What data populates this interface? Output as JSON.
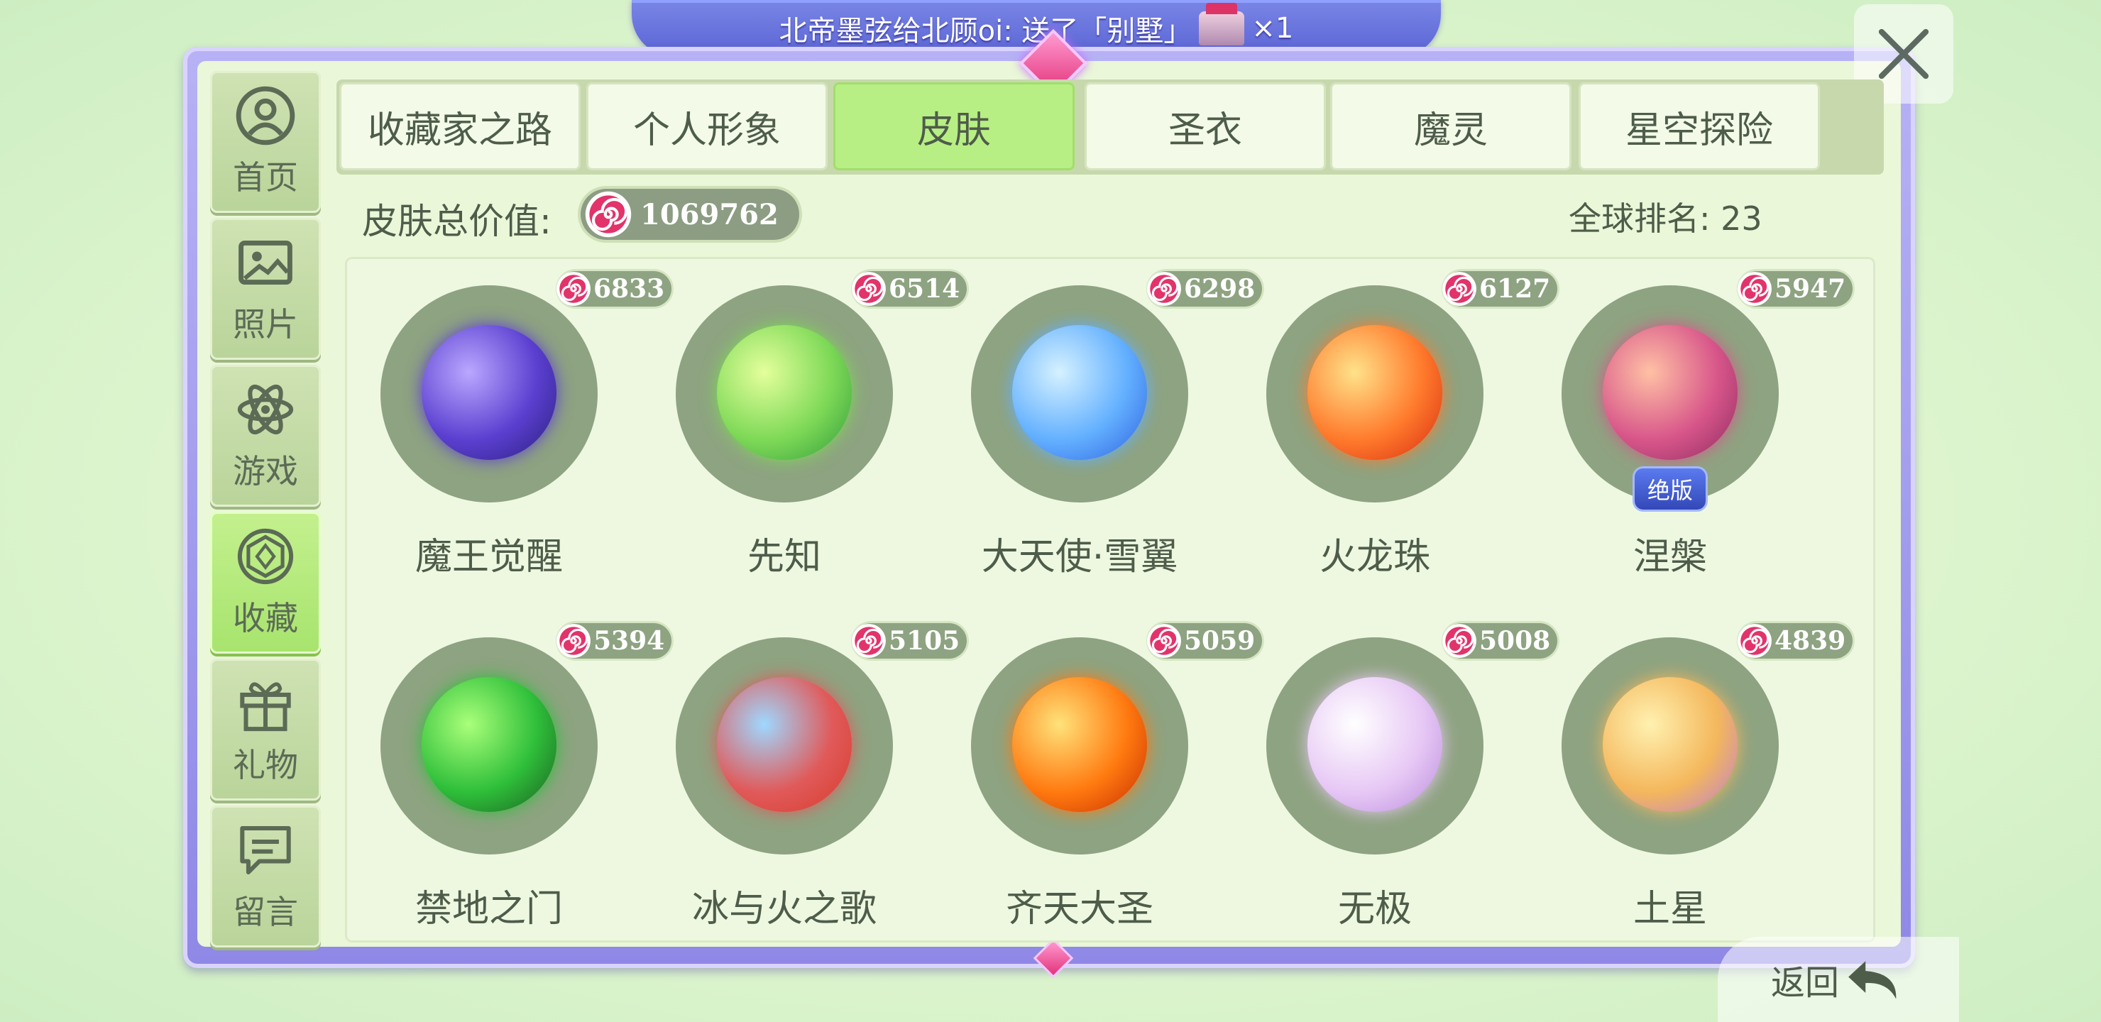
{
  "banner": {
    "text": "北帝墨弦给北顾oi: 送了「别墅」",
    "count": "×1"
  },
  "sidebar": {
    "items": [
      {
        "label": "首页",
        "icon": "person-icon",
        "active": false
      },
      {
        "label": "照片",
        "icon": "picture-icon",
        "active": false
      },
      {
        "label": "游戏",
        "icon": "atom-icon",
        "active": false
      },
      {
        "label": "收藏",
        "icon": "gem-icon",
        "active": true
      },
      {
        "label": "礼物",
        "icon": "gift-icon",
        "active": false
      },
      {
        "label": "留言",
        "icon": "message-icon",
        "active": false
      }
    ]
  },
  "tabs": [
    {
      "label": "收藏家之路",
      "active": false
    },
    {
      "label": "个人形象",
      "active": false
    },
    {
      "label": "皮肤",
      "active": true
    },
    {
      "label": "圣衣",
      "active": false
    },
    {
      "label": "魔灵",
      "active": false
    },
    {
      "label": "星空探险",
      "active": false
    }
  ],
  "summary": {
    "value_label": "皮肤总价值:",
    "total_value": "1069762",
    "rank_text": "全球排名: 23"
  },
  "items": [
    {
      "name": "魔王觉醒",
      "price": "6833",
      "colors": [
        "#b9a8ff",
        "#5b3fd0",
        "#2a1f7a"
      ],
      "stamp": ""
    },
    {
      "name": "先知",
      "price": "6514",
      "colors": [
        "#e4ff9c",
        "#7ed957",
        "#2e9b3a"
      ],
      "stamp": ""
    },
    {
      "name": "大天使·雪翼",
      "price": "6298",
      "colors": [
        "#d5f1ff",
        "#63b0ff",
        "#2c5fe0"
      ],
      "stamp": ""
    },
    {
      "name": "火龙珠",
      "price": "6127",
      "colors": [
        "#ffe28a",
        "#ff7a2c",
        "#d62a10"
      ],
      "stamp": ""
    },
    {
      "name": "涅槃",
      "price": "5947",
      "colors": [
        "#ffc1a5",
        "#d8568a",
        "#8a2a60"
      ],
      "stamp": "绝版"
    },
    {
      "name": "禁地之门",
      "price": "5394",
      "colors": [
        "#aaff7a",
        "#2fbf3a",
        "#1a5a20"
      ],
      "stamp": ""
    },
    {
      "name": "冰与火之歌",
      "price": "5105",
      "colors": [
        "#9fd8ff",
        "#e05a5a",
        "#d83a2a"
      ],
      "stamp": ""
    },
    {
      "name": "齐天大圣",
      "price": "5059",
      "colors": [
        "#ffe27a",
        "#ff7a10",
        "#c62a00"
      ],
      "stamp": ""
    },
    {
      "name": "无极",
      "price": "5008",
      "colors": [
        "#ffffff",
        "#e7c8f5",
        "#b98bdc"
      ],
      "stamp": ""
    },
    {
      "name": "土星",
      "price": "4839",
      "colors": [
        "#fff1b0",
        "#f4b75c",
        "#b97bd6"
      ],
      "stamp": ""
    }
  ],
  "return_label": "返回",
  "accent": {
    "tab_active": "#b8ef84",
    "frame": "#8f88e6",
    "currency": "#e2336a"
  }
}
